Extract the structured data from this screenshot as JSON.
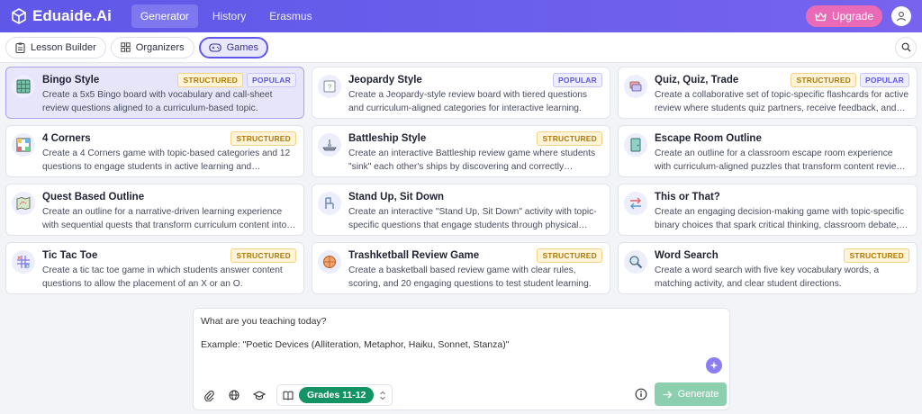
{
  "header": {
    "logo_text": "Eduaide.Ai",
    "nav": [
      "Generator",
      "History",
      "Erasmus"
    ],
    "upgrade_label": "Upgrade"
  },
  "subtabs": [
    "Lesson Builder",
    "Organizers",
    "Games"
  ],
  "cards": [
    {
      "title": "Bingo Style",
      "badges": [
        "STRUCTURED",
        "POPULAR"
      ],
      "desc": "Create a 5x5 Bingo board with vocabulary and call-sheet review questions aligned to a curriculum-based topic.",
      "icon": "bingo-icon",
      "selected": true
    },
    {
      "title": "Jeopardy Style",
      "badges": [
        "POPULAR"
      ],
      "desc": "Create a Jeopardy-style review board with tiered questions and curriculum-aligned categories for interactive learning.",
      "icon": "jeopardy-icon"
    },
    {
      "title": "Quiz, Quiz, Trade",
      "badges": [
        "STRUCTURED",
        "POPULAR"
      ],
      "desc": "Create a collaborative set of topic-specific flashcards for active review where students quiz partners, receive feedback, and trade cards.",
      "icon": "flashcards-icon"
    },
    {
      "title": "4 Corners",
      "badges": [
        "STRUCTURED"
      ],
      "desc": "Create a 4 Corners game with topic-based categories and 12 questions to engage students in active learning and discussion.",
      "icon": "four-corners-icon"
    },
    {
      "title": "Battleship Style",
      "badges": [
        "STRUCTURED"
      ],
      "desc": "Create an interactive Battleship review game where students \"sink\" each other's ships by discovering and correctly answering questions.",
      "icon": "battleship-icon"
    },
    {
      "title": "Escape Room Outline",
      "badges": [],
      "desc": "Create an outline for a classroom escape room experience with curriculum-aligned puzzles that transform content review into an adventure.",
      "icon": "door-icon"
    },
    {
      "title": "Quest Based Outline",
      "badges": [],
      "desc": "Create an outline for a narrative-driven learning experience with sequential quests that transform curriculum content into an adventure.",
      "icon": "map-icon"
    },
    {
      "title": "Stand Up, Sit Down",
      "badges": [],
      "desc": "Create an interactive \"Stand Up, Sit Down\" activity with topic-specific questions that engage students through physical movement.",
      "icon": "chair-icon"
    },
    {
      "title": "This or That?",
      "badges": [],
      "desc": "Create an engaging decision-making game with topic-specific binary choices that spark critical thinking, classroom debate, and reflection.",
      "icon": "arrows-swap-icon"
    },
    {
      "title": "Tic Tac Toe",
      "badges": [
        "STRUCTURED"
      ],
      "desc": "Create a tic tac toe game in which students answer content questions to allow the placement of an X or an O.",
      "icon": "tic-tac-toe-icon"
    },
    {
      "title": "Trashketball Review Game",
      "badges": [
        "STRUCTURED"
      ],
      "desc": "Create a basketball based review game with clear rules, scoring, and 20 engaging questions to test student learning.",
      "icon": "basketball-icon"
    },
    {
      "title": "Word Search",
      "badges": [
        "STRUCTURED"
      ],
      "desc": "Create a word search with five key vocabulary words, a matching activity, and clear student directions.",
      "icon": "magnifier-icon"
    }
  ],
  "prompt": {
    "line1": "What are you teaching today?",
    "line2": "Example: \"Poetic Devices (Alliteration, Metaphor, Haiku, Sonnet, Stanza)\"",
    "grade": "Grades 11-12",
    "generate_label": "Generate"
  },
  "colors": {
    "accent": "#5f57e8",
    "upgrade": "#e96bb8",
    "grade": "#149365",
    "generate": "#8ccfae"
  }
}
